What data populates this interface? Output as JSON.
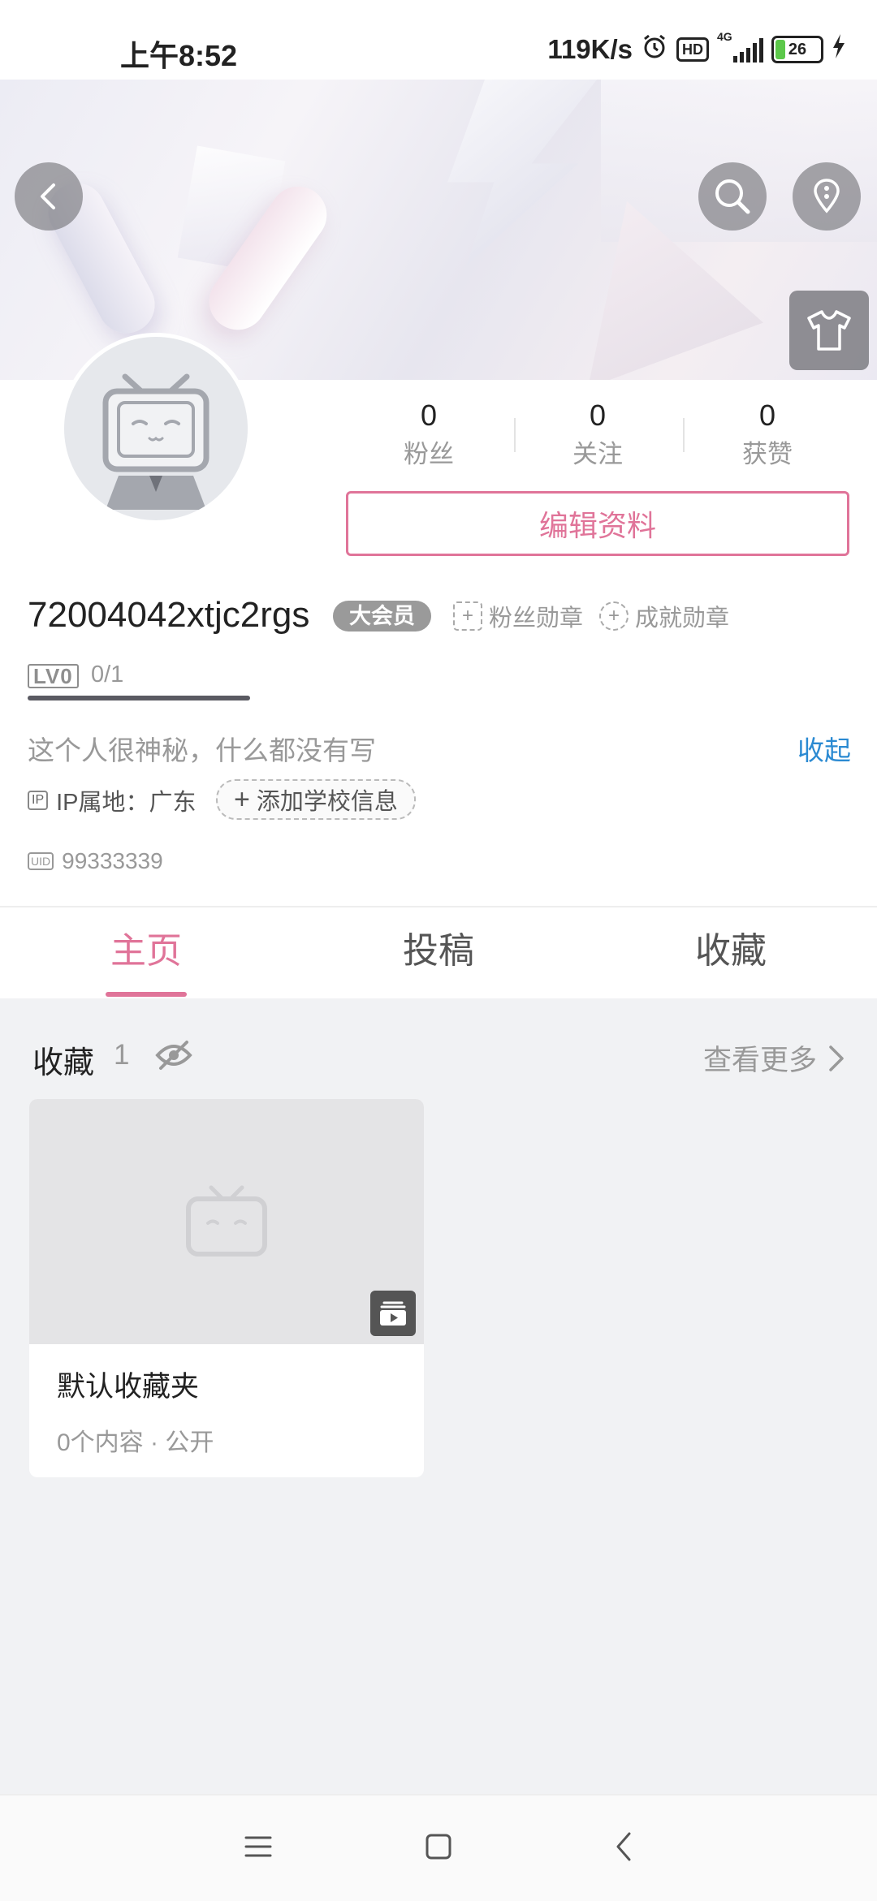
{
  "status_bar": {
    "time": "上午8:52",
    "speed": "119K/s",
    "hd": "HD",
    "network": "4G",
    "battery": "26"
  },
  "profile": {
    "stats": [
      {
        "value": "0",
        "label": "粉丝"
      },
      {
        "value": "0",
        "label": "关注"
      },
      {
        "value": "0",
        "label": "获赞"
      }
    ],
    "edit_label": "编辑资料",
    "username": "72004042xtjc2rgs",
    "vip_label": "大会员",
    "fan_medal_label": "粉丝勋章",
    "achievement_medal_label": "成就勋章",
    "level_tag": "LV0",
    "level_progress": "0/1",
    "bio": "这个人很神秘，什么都没有写",
    "collapse_label": "收起",
    "ip_icon": "IP",
    "ip_location": "IP属地：广东",
    "add_school_label": "添加学校信息",
    "uid_icon": "UID",
    "uid": "99333339"
  },
  "tabs": [
    {
      "label": "主页",
      "active": true
    },
    {
      "label": "投稿",
      "active": false
    },
    {
      "label": "收藏",
      "active": false
    }
  ],
  "favorites": {
    "title": "收藏",
    "count": "1",
    "see_more_label": "查看更多",
    "cards": [
      {
        "title": "默认收藏夹",
        "meta": "0个内容 · 公开"
      }
    ]
  },
  "colors": {
    "accent": "#e07499",
    "link": "#2b8ad2",
    "content_bg": "#f1f2f4"
  },
  "icons": [
    "back-arrow-icon",
    "search-icon",
    "more-icon",
    "shirt-icon",
    "alarm-icon",
    "signal-icon",
    "battery-icon",
    "charging-icon",
    "eye-off-icon",
    "chevron-right-icon",
    "menu-icon",
    "home-icon",
    "back-icon"
  ]
}
